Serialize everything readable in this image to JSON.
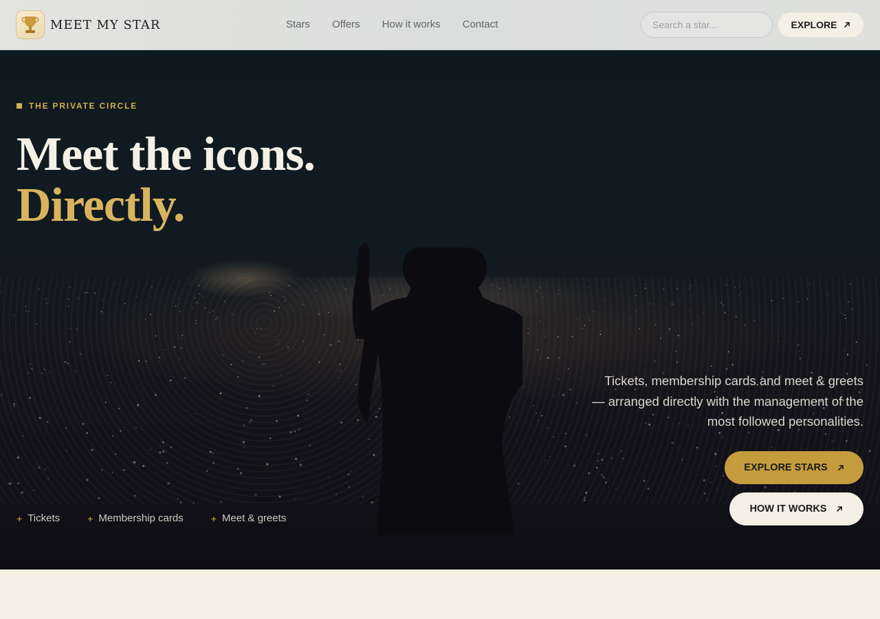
{
  "brand": {
    "name": "MEET MY STAR",
    "logo_icon": "trophy-icon"
  },
  "nav": [
    {
      "label": "Stars"
    },
    {
      "label": "Offers"
    },
    {
      "label": "How it works"
    },
    {
      "label": "Contact"
    }
  ],
  "search": {
    "placeholder": "Search a star...",
    "value": ""
  },
  "header_cta": {
    "label": "EXPLORE",
    "icon": "arrow-up-right-icon"
  },
  "hero": {
    "eyebrow": "THE PRIVATE CIRCLE",
    "headline_line1": "Meet the icons.",
    "headline_line2": "Directly.",
    "description": "Tickets, membership cards and meet & greets — arranged directly with the management of the most followed personalities.",
    "primary_cta": "EXPLORE STARS",
    "secondary_cta": "HOW IT WORKS",
    "features": [
      {
        "label": "Tickets"
      },
      {
        "label": "Membership cards"
      },
      {
        "label": "Meet & greets"
      }
    ],
    "feature_marker": "+"
  },
  "colors": {
    "gold": "#d4b04f",
    "gold_button": "#c59c3d",
    "cream": "#f4f0e6",
    "hero_dark": "#111a20",
    "header_bg": "#dcdedd"
  }
}
